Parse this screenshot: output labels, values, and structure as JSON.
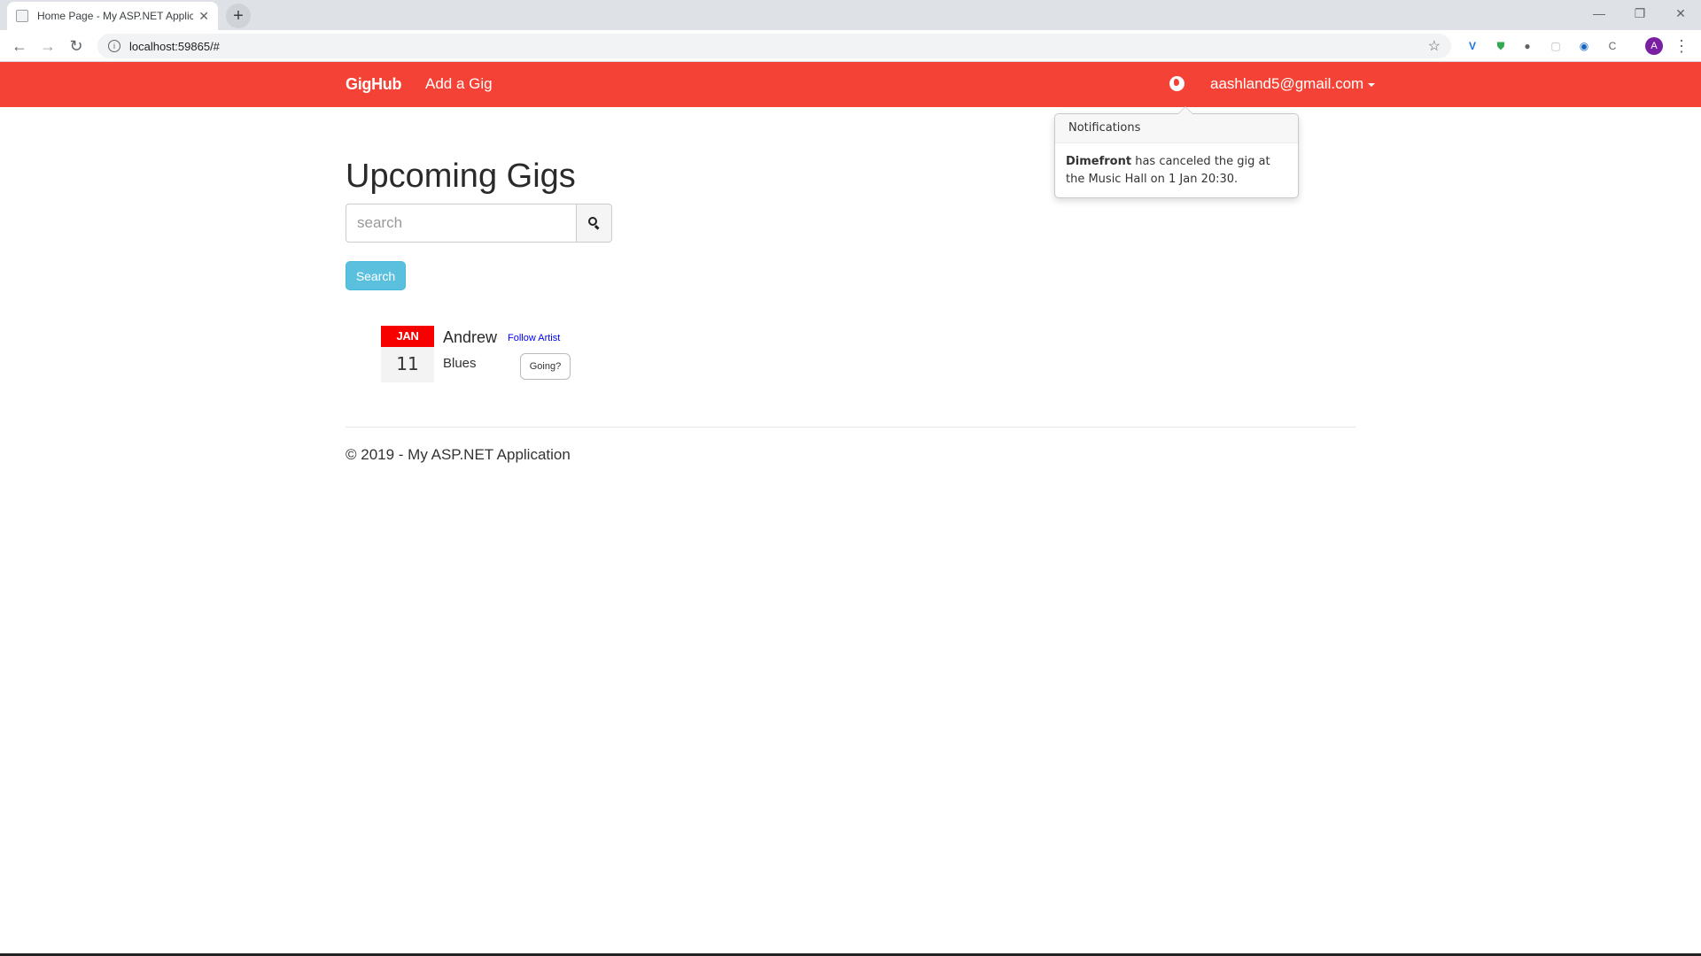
{
  "browser": {
    "tab_title": "Home Page - My ASP.NET Applic",
    "tab_close": "✕",
    "new_tab": "+",
    "url": "localhost:59865/#",
    "profile_initial": "A",
    "window_controls": {
      "minimize": "—",
      "restore": "❐",
      "close": "✕"
    }
  },
  "navbar": {
    "brand": "GigHub",
    "add_gig": "Add a Gig",
    "user_email": "aashland5@gmail.com",
    "color": "#f44336"
  },
  "notifications": {
    "title": "Notifications",
    "items": [
      {
        "actor": "Dimefront",
        "message": " has canceled the gig at the Music Hall on 1 Jan 20:30."
      }
    ]
  },
  "main": {
    "title": "Upcoming Gigs",
    "search_placeholder": "search",
    "search_button": "Search",
    "gigs": [
      {
        "month": "JAN",
        "day": "11",
        "artist": "Andrew",
        "follow_label": "Follow Artist",
        "genre": "Blues",
        "going_label": "Going?"
      }
    ]
  },
  "footer": {
    "text": "© 2019 - My ASP.NET Application"
  }
}
